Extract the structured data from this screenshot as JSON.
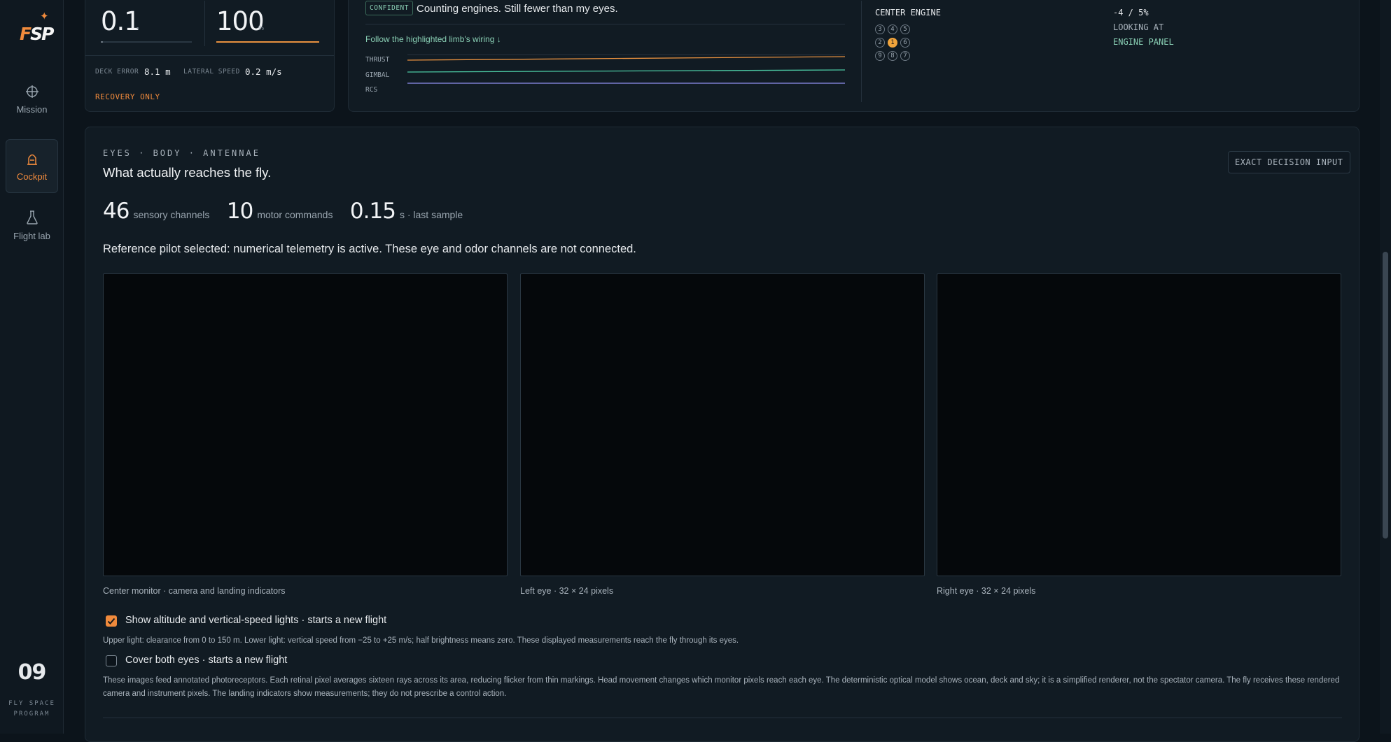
{
  "sidebar": {
    "logo_text": "FSP",
    "items": [
      {
        "label": "Mission"
      },
      {
        "label": "Cockpit"
      },
      {
        "label": "Flight lab"
      }
    ],
    "version": "09",
    "program": "FLY SPACE PROGRAM"
  },
  "left_panel": {
    "value_a": "0.1",
    "value_a_fill": 0.02,
    "value_b": "100",
    "value_b_unit": "%",
    "value_b_fill": 1.0,
    "deck_error_label": "DECK ERROR",
    "deck_error_value": "8.1 m",
    "lateral_speed_label": "LATERAL SPEED",
    "lateral_speed_value": "0.2 m/s",
    "status": "RECOVERY ONLY"
  },
  "mid_panel": {
    "badge": "CONFIDENT",
    "message": "Counting engines. Still fewer than my eyes.",
    "link": "Follow the highlighted limb's wiring ↓",
    "traces": [
      {
        "label": "THRUST",
        "color": "#e8913f"
      },
      {
        "label": "GIMBAL",
        "color": "#4cc9a3"
      },
      {
        "label": "RCS",
        "color": "#8f8ff0"
      }
    ],
    "engine_label": "CENTER ENGINE",
    "engine_rows": [
      [
        "3",
        "4",
        "5"
      ],
      [
        "2",
        "1",
        "6"
      ],
      [
        "9",
        "8",
        "7"
      ]
    ],
    "engine_active": "1",
    "right_value": "-4 / 5%",
    "looking_label": "LOOKING AT",
    "looking_value": "ENGINE PANEL"
  },
  "main": {
    "section_label": "EYES · BODY · ANTENNAE",
    "title": "What actually reaches the fly.",
    "exact_button": "EXACT DECISION INPUT",
    "stats": [
      {
        "num": "46",
        "label": "sensory channels"
      },
      {
        "num": "10",
        "label": "motor commands"
      },
      {
        "num": "0.15",
        "label": "s · last sample"
      }
    ],
    "notice": "Reference pilot selected: numerical telemetry is active. These eye and odor channels are not connected.",
    "captions": [
      "Center monitor · camera and landing indicators",
      "Left eye · 32 × 24 pixels",
      "Right eye · 32 × 24 pixels"
    ],
    "option1": {
      "label": "Show altitude and vertical-speed lights · starts a new flight",
      "checked": true,
      "help": "Upper light: clearance from 0 to 150 m. Lower light: vertical speed from −25 to +25 m/s; half brightness means zero. These displayed measurements reach the fly through its eyes."
    },
    "option2": {
      "label": "Cover both eyes · starts a new flight",
      "checked": false
    },
    "help_text": "These images feed annotated photoreceptors. Each retinal pixel averages sixteen rays across its area, reducing flicker from thin markings. Head movement changes which monitor pixels reach each eye. The deterministic optical model shows ocean, deck and sky; it is a simplified renderer, not the spectator camera. The fly receives these rendered camera and instrument pixels. The landing indicators show measurements; they do not prescribe a control action."
  }
}
